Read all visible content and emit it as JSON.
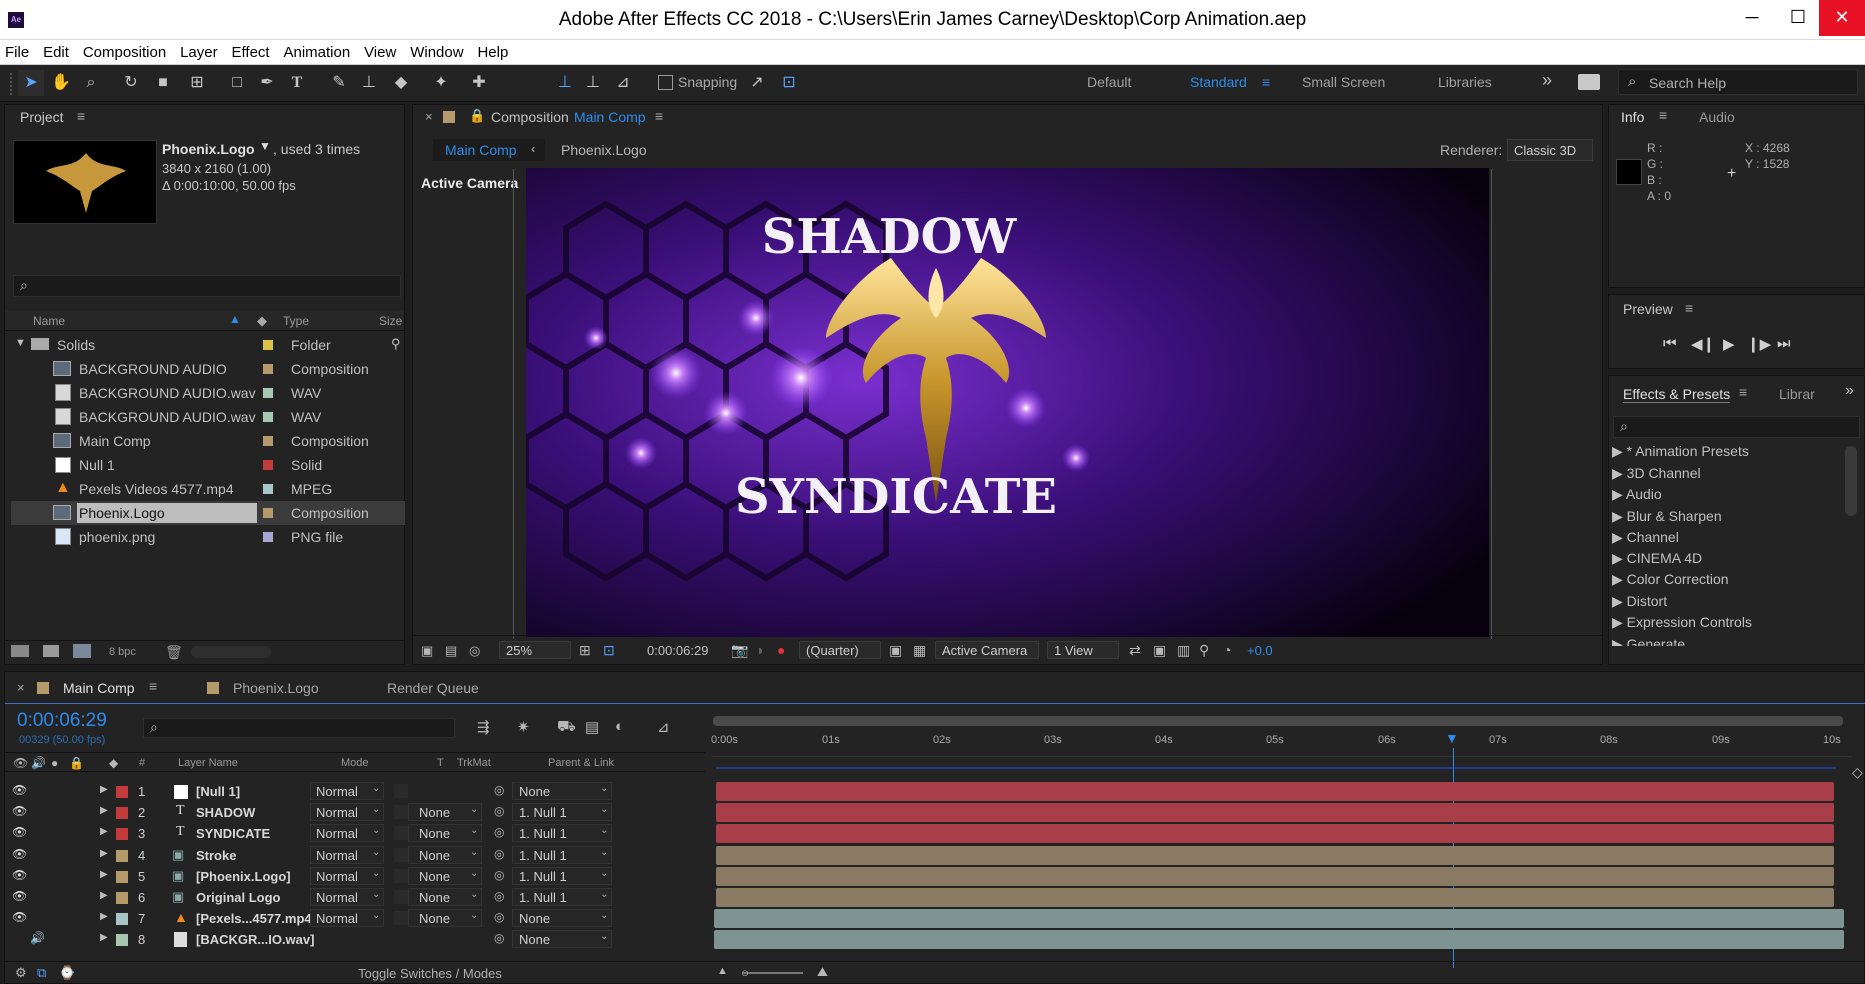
{
  "window": {
    "title": "Adobe After Effects CC 2018 - C:\\Users\\Erin James Carney\\Desktop\\Corp Animation.aep",
    "app_icon": "Ae"
  },
  "menu": [
    "File",
    "Edit",
    "Composition",
    "Layer",
    "Effect",
    "Animation",
    "View",
    "Window",
    "Help"
  ],
  "toolbar": {
    "snapping_label": "Snapping",
    "workspaces": [
      "Default",
      "Standard",
      "Small Screen",
      "Libraries"
    ],
    "active_workspace": "Standard",
    "search_placeholder": "Search Help"
  },
  "project": {
    "tab": "Project",
    "selected_name": "Phoenix.Logo",
    "used": ", used 3 times",
    "resolution": "3840 x 2160 (1.00)",
    "duration": "Δ 0:00:10:00, 50.00 fps",
    "columns": [
      "Name",
      "Type",
      "Size"
    ],
    "items": [
      {
        "name": "Solids",
        "type": "Folder",
        "color": "#d9c24a"
      },
      {
        "name": "BACKGROUND AUDIO",
        "type": "Composition",
        "color": "#b59a6c"
      },
      {
        "name": "BACKGROUND AUDIO.wav",
        "type": "WAV",
        "color": "#a6c7b2"
      },
      {
        "name": "BACKGROUND AUDIO.wav",
        "type": "WAV",
        "color": "#a6c7b2"
      },
      {
        "name": "Main Comp",
        "type": "Composition",
        "color": "#b59a6c"
      },
      {
        "name": "Null 1",
        "type": "Solid",
        "color": "#c33b3b"
      },
      {
        "name": "Pexels Videos 4577.mp4",
        "type": "MPEG",
        "color": "#a6c7c6"
      },
      {
        "name": "Phoenix.Logo",
        "type": "Composition",
        "color": "#b59a6c"
      },
      {
        "name": "phoenix.png",
        "type": "PNG file",
        "color": "#a7a6d0"
      }
    ],
    "bpc": "8 bpc"
  },
  "composition": {
    "tab_prefix": "Composition",
    "tab_name": "Main Comp",
    "breadcrumbs": [
      "Main Comp",
      "Phoenix.Logo"
    ],
    "renderer_label": "Renderer:",
    "renderer_value": "Classic 3D",
    "camera_label": "Active Camera",
    "title_top": "SHADOW",
    "title_bottom": "SYNDICATE",
    "zoom": "25%",
    "timecode": "0:00:06:29",
    "resolution": "(Quarter)",
    "view": "Active Camera",
    "views": "1 View",
    "exposure": "+0.0"
  },
  "info": {
    "tabs": [
      "Info",
      "Audio"
    ],
    "r": "R :",
    "g": "G :",
    "b": "B :",
    "a": "A :  0",
    "x": "X : 4268",
    "y": "Y : 1528"
  },
  "preview": {
    "tab": "Preview"
  },
  "effects": {
    "tabs": [
      "Effects & Presets",
      "Librar"
    ],
    "items": [
      "* Animation Presets",
      "3D Channel",
      "Audio",
      "Blur & Sharpen",
      "Channel",
      "CINEMA 4D",
      "Color Correction",
      "Distort",
      "Expression Controls",
      "Generate"
    ]
  },
  "timeline": {
    "tabs": [
      "Main Comp",
      "Phoenix.Logo",
      "Render Queue"
    ],
    "timecode": "0:00:06:29",
    "frames": "00329 (50.00 fps)",
    "headers": {
      "num": "#",
      "name": "Layer Name",
      "mode": "Mode",
      "t": "T",
      "trkmat": "TrkMat",
      "parent": "Parent & Link"
    },
    "ruler": [
      "0:00s",
      "01s",
      "02s",
      "03s",
      "04s",
      "05s",
      "06s",
      "07s",
      "08s",
      "09s",
      "10s"
    ],
    "layers": [
      {
        "num": "1",
        "name": "[Null 1]",
        "mode": "Normal",
        "trkmat": "",
        "parent": "None",
        "color": "#c33b3b",
        "bar": "#a83f48"
      },
      {
        "num": "2",
        "name": "SHADOW",
        "mode": "Normal",
        "trkmat": "None",
        "parent": "1. Null 1",
        "color": "#c33b3b",
        "bar": "#a83f48"
      },
      {
        "num": "3",
        "name": "SYNDICATE",
        "mode": "Normal",
        "trkmat": "None",
        "parent": "1. Null 1",
        "color": "#c33b3b",
        "bar": "#a83f48"
      },
      {
        "num": "4",
        "name": "Stroke",
        "mode": "Normal",
        "trkmat": "None",
        "parent": "1. Null 1",
        "color": "#b59a6c",
        "bar": "#8a7a64"
      },
      {
        "num": "5",
        "name": "[Phoenix.Logo]",
        "mode": "Normal",
        "trkmat": "None",
        "parent": "1. Null 1",
        "color": "#b59a6c",
        "bar": "#8a7a64"
      },
      {
        "num": "6",
        "name": "Original Logo",
        "mode": "Normal",
        "trkmat": "None",
        "parent": "1. Null 1",
        "color": "#b59a6c",
        "bar": "#8a7a64"
      },
      {
        "num": "7",
        "name": "[Pexels...4577.mp4]",
        "mode": "Normal",
        "trkmat": "None",
        "parent": "None",
        "color": "#a6c7c6",
        "bar": "#7e9492"
      },
      {
        "num": "8",
        "name": "[BACKGR...IO.wav]",
        "mode": "",
        "trkmat": "",
        "parent": "None",
        "color": "#a6c7b2",
        "bar": "#7e9492"
      }
    ],
    "toggle_label": "Toggle Switches / Modes"
  }
}
